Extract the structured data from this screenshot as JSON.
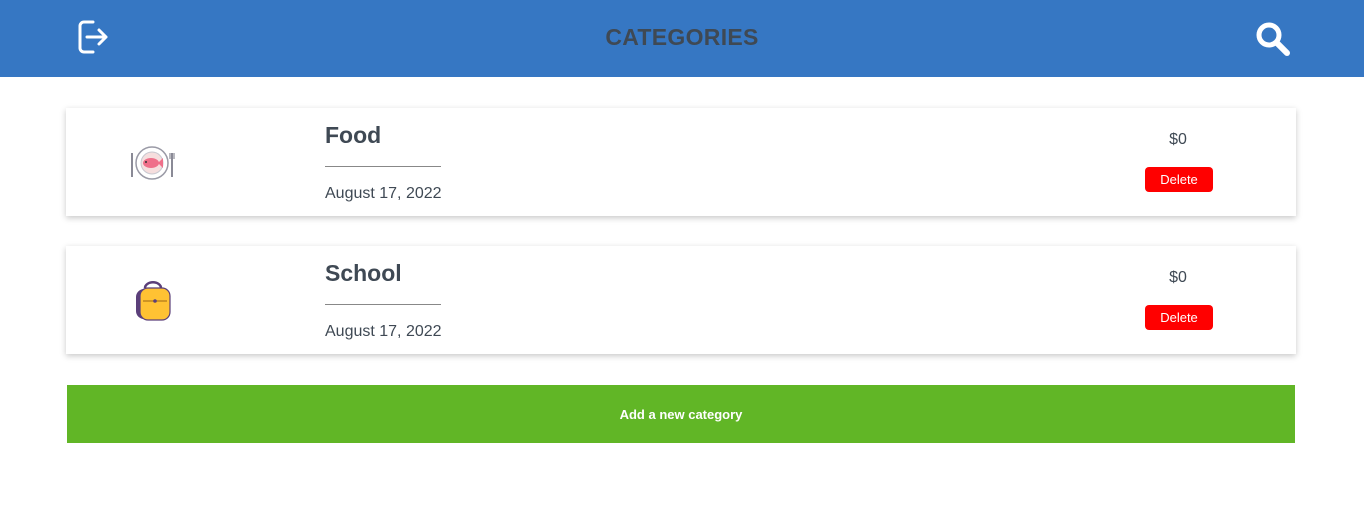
{
  "header": {
    "title": "CATEGORIES",
    "logout_icon": "logout-icon",
    "search_icon": "search-icon",
    "background": "#3677c3"
  },
  "categories": [
    {
      "name": "Food",
      "date": "August 17, 2022",
      "amount": "$0",
      "delete_label": "Delete",
      "icon": "plate-fish-icon"
    },
    {
      "name": "School",
      "date": "August 17, 2022",
      "amount": "$0",
      "delete_label": "Delete",
      "icon": "backpack-icon"
    }
  ],
  "actions": {
    "add_label": "Add a new category",
    "add_color": "#61b626",
    "delete_color": "#ff0000"
  }
}
